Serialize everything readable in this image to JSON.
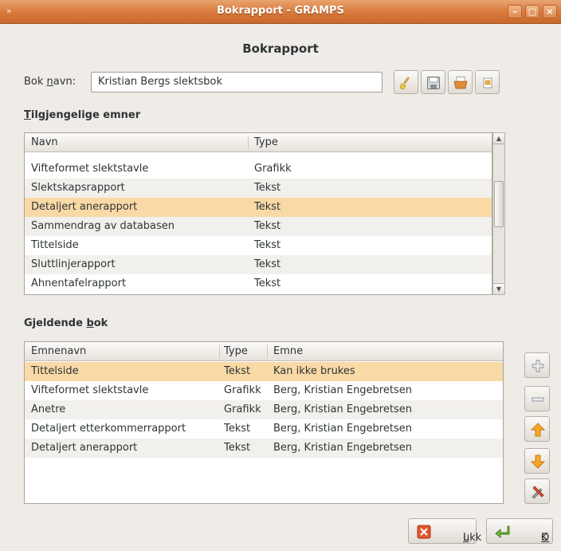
{
  "window": {
    "title": "Bokrapport - GRAMPS",
    "controls": [
      "minimize",
      "maximize",
      "close"
    ]
  },
  "heading": "Bokrapport",
  "book_name": {
    "label_pre": "Bok ",
    "label_mnemonic": "n",
    "label_post": "avn:",
    "value": "Kristian Bergs slektsbok"
  },
  "toolbar": {
    "icons": [
      "clear-icon",
      "save-icon",
      "open-icon",
      "edit-books-icon"
    ]
  },
  "available": {
    "title_mnemonic": "T",
    "title_rest": "ilgjengelige emner",
    "columns": [
      "Navn",
      "Type"
    ],
    "rows": [
      {
        "name": "Vifteformet slektstavle",
        "type": "Grafikk"
      },
      {
        "name": "Slektskapsrapport",
        "type": "Tekst"
      },
      {
        "name": "Detaljert anerapport",
        "type": "Tekst"
      },
      {
        "name": "Sammendrag av databasen",
        "type": "Tekst"
      },
      {
        "name": "Tittelside",
        "type": "Tekst"
      },
      {
        "name": "Sluttlinjerapport",
        "type": "Tekst"
      },
      {
        "name": "Ahnentafelrapport",
        "type": "Tekst"
      }
    ],
    "selected_index": 2
  },
  "current": {
    "title_pre": "Gjeldende ",
    "title_mnemonic": "b",
    "title_post": "ok",
    "columns": [
      "Emnenavn",
      "Type",
      "Emne"
    ],
    "rows": [
      {
        "name": "Tittelside",
        "type": "Tekst",
        "subject": "Kan ikke brukes"
      },
      {
        "name": "Vifteformet slektstavle",
        "type": "Grafikk",
        "subject": "Berg, Kristian Engebretsen"
      },
      {
        "name": "Anetre",
        "type": "Grafikk",
        "subject": "Berg, Kristian Engebretsen"
      },
      {
        "name": "Detaljert etterkommerrapport",
        "type": "Tekst",
        "subject": "Berg, Kristian Engebretsen"
      },
      {
        "name": "Detaljert anerapport",
        "type": "Tekst",
        "subject": "Berg, Kristian Engebretsen"
      }
    ],
    "selected_index": 0
  },
  "side_buttons": [
    "add-icon",
    "remove-icon",
    "move-up-icon",
    "move-down-icon",
    "configure-icon"
  ],
  "buttons": {
    "close_mnemonic": "L",
    "close_rest": "ukk",
    "ok_mnemonic": "O",
    "ok_rest": "K"
  },
  "colors": {
    "titlebar": "#d97b3e",
    "selection": "#f9d9a6",
    "window_bg": "#efebe7"
  }
}
